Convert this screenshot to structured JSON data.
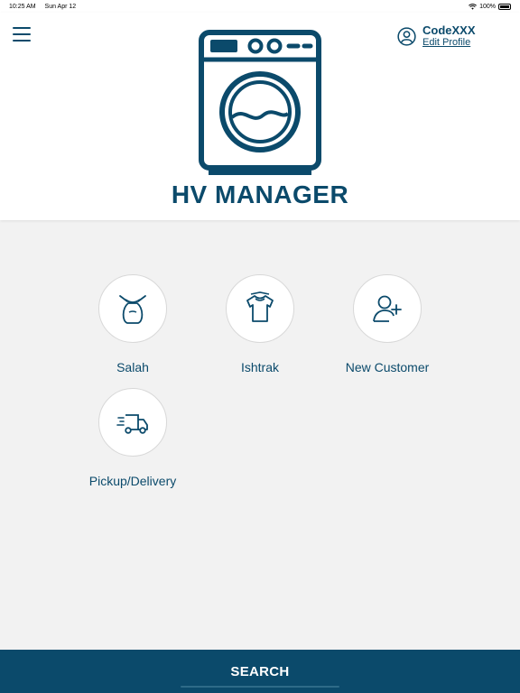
{
  "status": {
    "time": "10:25 AM",
    "date": "Sun Apr 12",
    "battery": "100%"
  },
  "header": {
    "menu_icon": "hamburger-menu-icon",
    "app_title": "HV MANAGER",
    "logo_icon": "washing-machine-icon",
    "profile": {
      "name": "CodeXXX",
      "edit_label": "Edit Profile",
      "icon": "user-circle-icon"
    }
  },
  "tiles": [
    {
      "label": "Salah",
      "icon": "laundry-bag-icon"
    },
    {
      "label": "Ishtrak",
      "icon": "shirt-icon"
    },
    {
      "label": "New Customer",
      "icon": "add-user-icon"
    },
    {
      "label": "Pickup/Delivery",
      "icon": "delivery-truck-icon"
    }
  ],
  "footer": {
    "search_label": "SEARCH"
  },
  "colors": {
    "brand": "#0b4a6b",
    "background": "#f2f2f2",
    "header_bg": "#ffffff"
  }
}
